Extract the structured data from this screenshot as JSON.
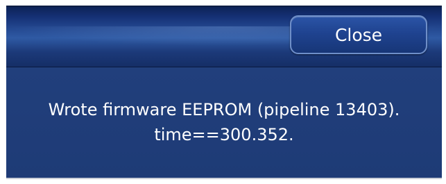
{
  "dialog": {
    "close_label": "Close",
    "message_line1": "Wrote firmware EEPROM (pipeline 13403).",
    "message_line2": "time==300.352."
  },
  "colors": {
    "dialog_background": "#1e3c78",
    "button_border": "#6f8fc9",
    "text": "#ffffff"
  }
}
